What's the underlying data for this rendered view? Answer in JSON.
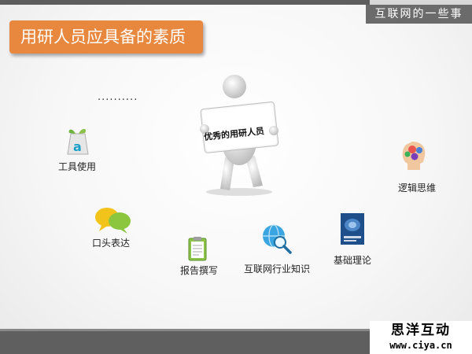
{
  "header": {
    "brand": "互联网的一些事"
  },
  "title": "用研人员应具备的素质",
  "ellipsis": "..........",
  "center": {
    "sign": "优秀的用研人员"
  },
  "skills": [
    {
      "label": "工具使用",
      "icon": "app-store-icon"
    },
    {
      "label": "逻辑思维",
      "icon": "head-gears-icon"
    },
    {
      "label": "口头表达",
      "icon": "speech-bubbles-icon"
    },
    {
      "label": "报告撰写",
      "icon": "clipboard-icon"
    },
    {
      "label": "互联网行业知识",
      "icon": "globe-search-icon"
    },
    {
      "label": "基础理论",
      "icon": "book-icon"
    }
  ],
  "footer": {
    "stamp_name": "思洋互动",
    "stamp_url": "www.ciya.cn"
  }
}
